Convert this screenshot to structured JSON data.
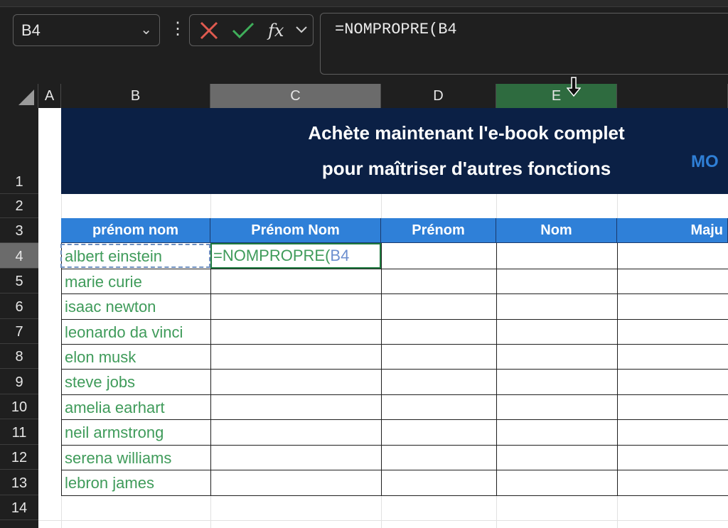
{
  "name_box": {
    "value": "B4"
  },
  "formula_bar": {
    "text": "=NOMPROPRE(B4"
  },
  "columns": [
    {
      "id": "A",
      "label": "A"
    },
    {
      "id": "B",
      "label": "B"
    },
    {
      "id": "C",
      "label": "C"
    },
    {
      "id": "D",
      "label": "D"
    },
    {
      "id": "E",
      "label": "E"
    }
  ],
  "rows": [
    "1",
    "2",
    "3",
    "4",
    "5",
    "6",
    "7",
    "8",
    "9",
    "10",
    "11",
    "12",
    "13",
    "14"
  ],
  "banner": {
    "line1": "Achète maintenant l'e-book complet",
    "line2": "pour maîtriser d'autres fonctions",
    "side": "MO"
  },
  "table": {
    "headers": [
      "prénom nom",
      "Prénom Nom",
      "Prénom",
      "Nom",
      "Maju"
    ],
    "names": [
      "albert einstein",
      "marie curie",
      "isaac newton",
      "leonardo da vinci",
      "elon musk",
      "steve jobs",
      "amelia earhart",
      "neil armstrong",
      "serena williams",
      "lebron james"
    ],
    "editing_prefix": "=NOMPROPRE(",
    "editing_ref": "B4"
  },
  "colors": {
    "banner_bg": "#0b2045",
    "header_bg": "#2f80d8",
    "name_text": "#3f9b5a",
    "active_border": "#1f7a3f"
  },
  "icons": {
    "cancel": "close-x-icon",
    "enter": "checkmark-icon",
    "function": "fx-icon"
  }
}
